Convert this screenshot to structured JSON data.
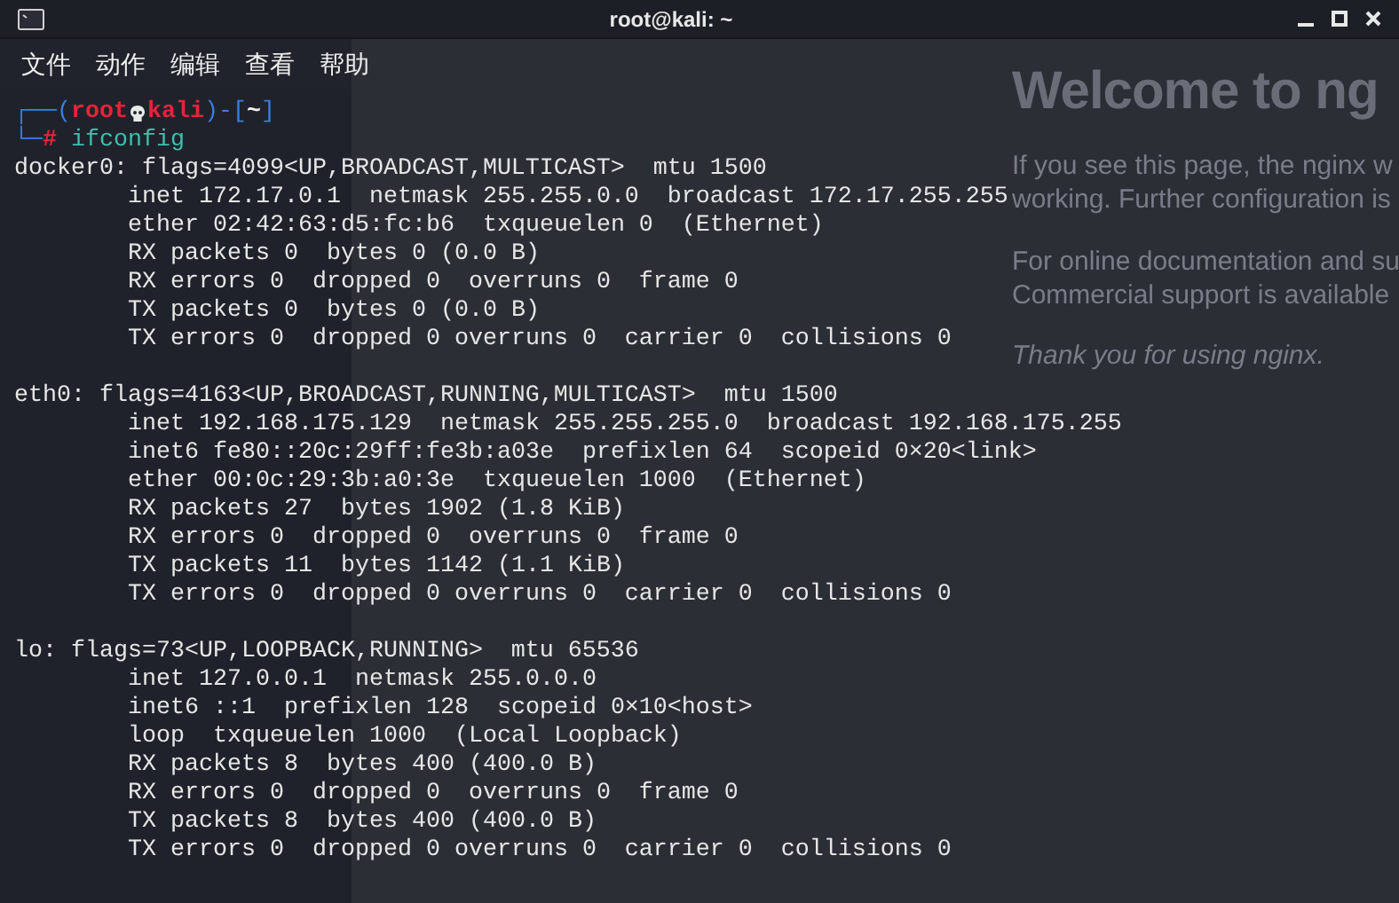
{
  "window": {
    "title": "root@kali: ~"
  },
  "menu": [
    "文件",
    "动作",
    "编辑",
    "查看",
    "帮助"
  ],
  "browser": {
    "heading": "Welcome to ng",
    "paragraphs": [
      [
        "If you see this page, the nginx w",
        "working. Further configuration is"
      ],
      [
        "For online documentation and su",
        "Commercial support is available"
      ]
    ],
    "closing": "Thank you for using nginx."
  },
  "prompt": {
    "open": "┌──(",
    "user": "root",
    "host": "kali",
    "mid": ")-[",
    "dir": "~",
    "close": "]",
    "corner": "└─",
    "symbol": "#",
    "command": "ifconfig"
  },
  "interfaces": [
    {
      "header": "docker0: flags=4099<UP,BROADCAST,MULTICAST>  mtu 1500",
      "details": [
        "inet 172.17.0.1  netmask 255.255.0.0  broadcast 172.17.255.255",
        "ether 02:42:63:d5:fc:b6  txqueuelen 0  (Ethernet)",
        "RX packets 0  bytes 0 (0.0 B)",
        "RX errors 0  dropped 0  overruns 0  frame 0",
        "TX packets 0  bytes 0 (0.0 B)",
        "TX errors 0  dropped 0 overruns 0  carrier 0  collisions 0"
      ]
    },
    {
      "header": "eth0: flags=4163<UP,BROADCAST,RUNNING,MULTICAST>  mtu 1500",
      "details": [
        "inet 192.168.175.129  netmask 255.255.255.0  broadcast 192.168.175.255",
        "inet6 fe80::20c:29ff:fe3b:a03e  prefixlen 64  scopeid 0×20<link>",
        "ether 00:0c:29:3b:a0:3e  txqueuelen 1000  (Ethernet)",
        "RX packets 27  bytes 1902 (1.8 KiB)",
        "RX errors 0  dropped 0  overruns 0  frame 0",
        "TX packets 11  bytes 1142 (1.1 KiB)",
        "TX errors 0  dropped 0 overruns 0  carrier 0  collisions 0"
      ]
    },
    {
      "header": "lo: flags=73<UP,LOOPBACK,RUNNING>  mtu 65536",
      "details": [
        "inet 127.0.0.1  netmask 255.0.0.0",
        "inet6 ::1  prefixlen 128  scopeid 0×10<host>",
        "loop  txqueuelen 1000  (Local Loopback)",
        "RX packets 8  bytes 400 (400.0 B)",
        "RX errors 0  dropped 0  overruns 0  frame 0",
        "TX packets 8  bytes 400 (400.0 B)",
        "TX errors 0  dropped 0 overruns 0  carrier 0  collisions 0"
      ]
    }
  ]
}
